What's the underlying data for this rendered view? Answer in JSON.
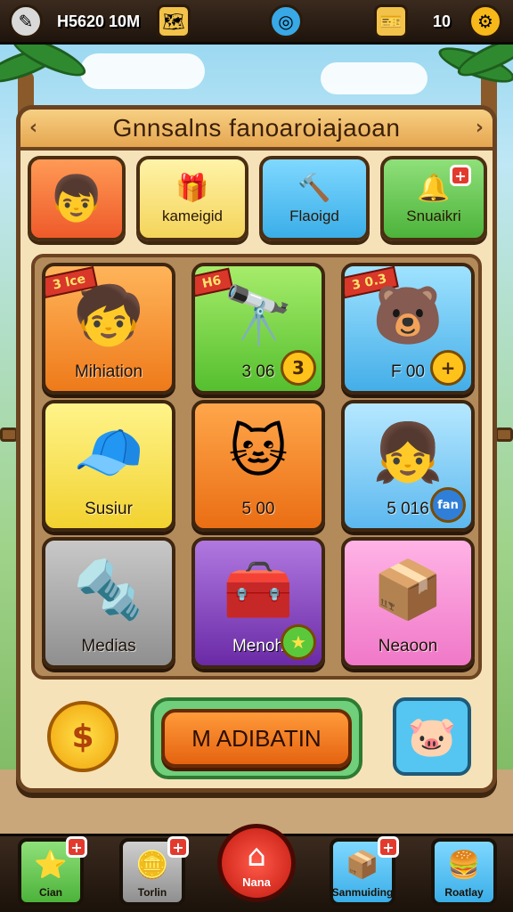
{
  "colors": {
    "panel": "#f6e2b8",
    "frame": "#6b4321",
    "accent_orange": "#ff9a3a",
    "accent_green": "#6fcf7a",
    "accent_blue": "#55c6f2"
  },
  "topbar": {
    "pencil_icon": "pencil-icon",
    "currency_text": "H5620 10M",
    "map_icon": "map-icon",
    "globe_icon": "globe-icon",
    "ticket_icon": "ticket-icon",
    "ticket_count": "10",
    "settings_icon": "gear-icon"
  },
  "panel": {
    "title": "Gnnsalns fanoaroiajaoan"
  },
  "tabs": [
    {
      "label": "",
      "icon": "character-icon"
    },
    {
      "label": "kameigid",
      "icon": "gift-icon"
    },
    {
      "label": "Flaoigd",
      "icon": "hammer-icon"
    },
    {
      "label": "Snuaikri",
      "icon": "bell-icon"
    }
  ],
  "cards": [
    {
      "label": "Mihiation",
      "ribbon": "3 lce",
      "art": "boy-icon"
    },
    {
      "label": "3 06",
      "ribbon": "H6",
      "art": "telescope-icon",
      "badge": "3"
    },
    {
      "label": "F 00",
      "ribbon": "3 0.3",
      "art": "blue-bear-icon",
      "badge": "+"
    },
    {
      "label": "Susiur",
      "art": "cap-boy-icon"
    },
    {
      "label": "5 00",
      "art": "yellow-cat-icon"
    },
    {
      "label": "5 016",
      "art": "girl-icon",
      "badge": "fan"
    },
    {
      "label": "Medias",
      "art": "cannon-icon"
    },
    {
      "label": "Menoh",
      "art": "chest-icon",
      "badge": "★"
    },
    {
      "label": "Neaoon",
      "art": "box-icon"
    }
  ],
  "bottom": {
    "sun_symbol": "$",
    "main_button": "M ADIBATIN",
    "pet_icon": "pig-icon"
  },
  "nav": [
    {
      "label": "Cian",
      "icon": "star-icon"
    },
    {
      "label": "Torlin",
      "icon": "coin-icon"
    },
    {
      "label": "Nana",
      "icon": "home-icon"
    },
    {
      "label": "Sanmuiding",
      "icon": "crate-icon"
    },
    {
      "label": "Roatlay",
      "icon": "burger-icon"
    }
  ]
}
